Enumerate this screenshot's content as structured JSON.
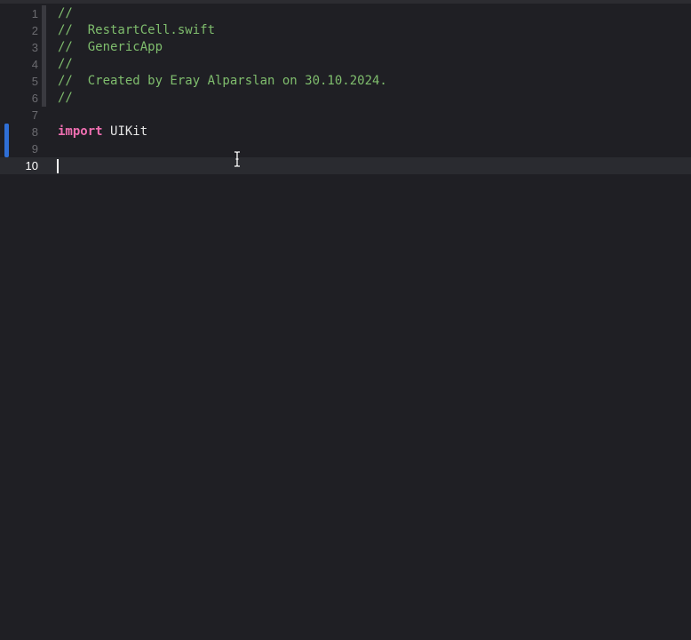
{
  "editor": {
    "lines": [
      {
        "num": "1",
        "comment": "//"
      },
      {
        "num": "2",
        "comment": "//  RestartCell.swift"
      },
      {
        "num": "3",
        "comment": "//  GenericApp"
      },
      {
        "num": "4",
        "comment": "//"
      },
      {
        "num": "5",
        "comment": "//  Created by Eray Alparslan on 30.10.2024."
      },
      {
        "num": "6",
        "comment": "//"
      },
      {
        "num": "7"
      },
      {
        "num": "8",
        "keyword": "import",
        "text": "UIKit"
      },
      {
        "num": "9"
      },
      {
        "num": "10"
      }
    ],
    "current_line": "10",
    "colors": {
      "background": "#1f1f24",
      "comment": "#7fbd6d",
      "keyword": "#ef6fb1",
      "change_marker": "#2f6fd6"
    }
  }
}
